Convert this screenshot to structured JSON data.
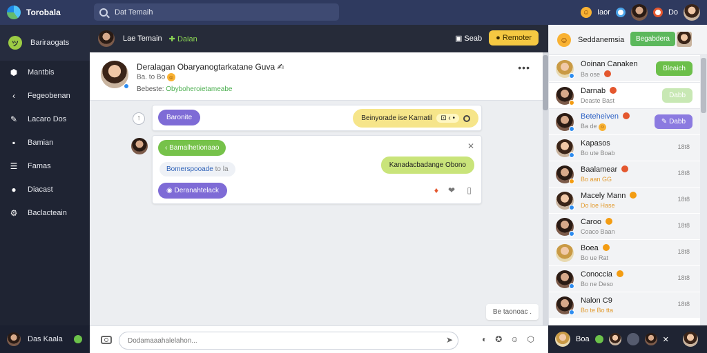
{
  "app": {
    "title": "Torobala"
  },
  "search": {
    "text": "Dat Temaih"
  },
  "topbar": {
    "user1": "Iaor",
    "user2": "Do"
  },
  "sidebar": {
    "items": [
      {
        "label": "Bariraogats",
        "icon": "leaf-icon"
      },
      {
        "label": "Mantbis",
        "icon": "home-icon"
      },
      {
        "label": "Fegeobenan",
        "icon": "send-icon"
      },
      {
        "label": "Lacaro Dos",
        "icon": "edit-icon"
      },
      {
        "label": "Bamian",
        "icon": "file-icon"
      },
      {
        "label": "Famas",
        "icon": "list-icon"
      },
      {
        "label": "Diacast",
        "icon": "chat-icon"
      },
      {
        "label": "Baclacteain",
        "icon": "settings-icon"
      }
    ],
    "footer_name": "Das Kaala"
  },
  "chat_header": {
    "name": "Lae Temain",
    "status": "Daian",
    "action_label": "Seab",
    "button_label": "Remoter"
  },
  "profile": {
    "name": "Deralagan Obaryanogtarkatane Guva",
    "sub": "Ba. to  Bo",
    "status_prefix": "Bebeste:",
    "status_value": "Obyboheroietameabe"
  },
  "messages": {
    "m1_button": "Baronite",
    "m1_bubble": "Beinyorade ise Karnatil",
    "m1_bubble_icons": "⊡ ‹ •",
    "m2_tag": "Bamalhetionaao",
    "m2_link": "Bomerspooade",
    "m2_link_time": "to la",
    "m2_reply": "Kanadacbadange Obono",
    "m2_button": "Deranahtelack",
    "toast": "Be taonoac ."
  },
  "composer": {
    "placeholder": "Dodamaaahalelahon..."
  },
  "right_panel": {
    "title": "Seddanemsia",
    "button": "Begabdera",
    "contacts": [
      {
        "name": "Ooinan Canaken",
        "sub": "Ba ose",
        "time": "",
        "pill": "Bleaich",
        "pill_color": "#6cbf4a"
      },
      {
        "name": "Darnab",
        "sub": "Deaste Bast",
        "time": "",
        "pill": "Dabb",
        "pill_color": "#b9dfa3"
      },
      {
        "name": "Beteheiven",
        "sub": "Ba de",
        "time": "",
        "pill": "Dabb",
        "pill_color": "#8b7ae0"
      },
      {
        "name": "Kapasos",
        "sub": "Bo ute Boab",
        "time": "18t8",
        "pill": "",
        "pill_color": ""
      },
      {
        "name": "Baalamear",
        "sub": "Bo aan GG",
        "time": "18t8",
        "pill": "",
        "pill_color": ""
      },
      {
        "name": "Macely Mann",
        "sub": "Do loe  Hase",
        "time": "18t8",
        "pill": "",
        "pill_color": ""
      },
      {
        "name": "Caroo",
        "sub": "Coaco Baan",
        "time": "18t8",
        "pill": "",
        "pill_color": ""
      },
      {
        "name": "Boea",
        "sub": "Bo ue Rat",
        "time": "18t8",
        "pill": "",
        "pill_color": ""
      },
      {
        "name": "Conoccia",
        "sub": "Bo ne Deso",
        "time": "18t8",
        "pill": "",
        "pill_color": ""
      },
      {
        "name": "Nalon C9",
        "sub": "Bo te  Bo tta",
        "time": "18t8",
        "pill": "",
        "pill_color": ""
      }
    ],
    "footer_label": "Boa"
  },
  "colors": {
    "topbar": "#2f3a5f",
    "sidebar": "#1f2433",
    "accent_purple": "#7e6bd6",
    "accent_green": "#76c24a",
    "accent_yellow": "#f5c842"
  }
}
